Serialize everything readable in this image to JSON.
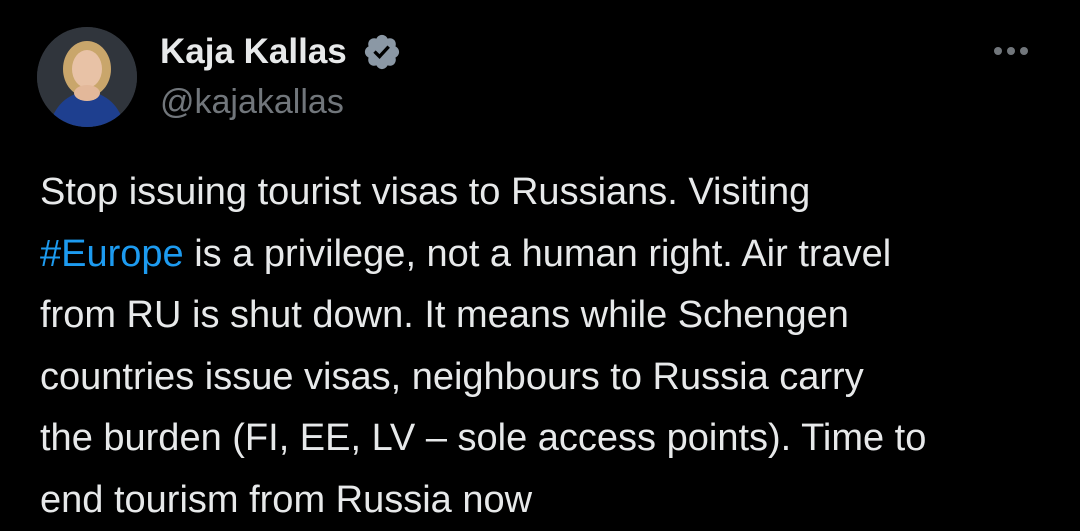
{
  "author": {
    "name": "Kaja Kallas",
    "handle": "@kajakallas",
    "verified_icon": "verified-badge-icon",
    "avatar_icon": "profile-photo"
  },
  "more_menu": {
    "icon": "more-options-icon"
  },
  "tweet": {
    "lines": [
      "Stop issuing tourist visas to Russians. Visiting",
      " is a privilege, not a human right. Air travel",
      "from RU is shut down. It means while Schengen",
      "countries issue visas, neighbours to Russia carry",
      "the burden (FI, EE, LV – sole access points). Time to",
      "end tourism from Russia now"
    ],
    "hashtag": "#Europe"
  },
  "colors": {
    "background": "#000000",
    "text": "#e7e9ea",
    "secondary_text": "#71767b",
    "link": "#1d9bf0",
    "verified_badge": "#8b98a5"
  }
}
